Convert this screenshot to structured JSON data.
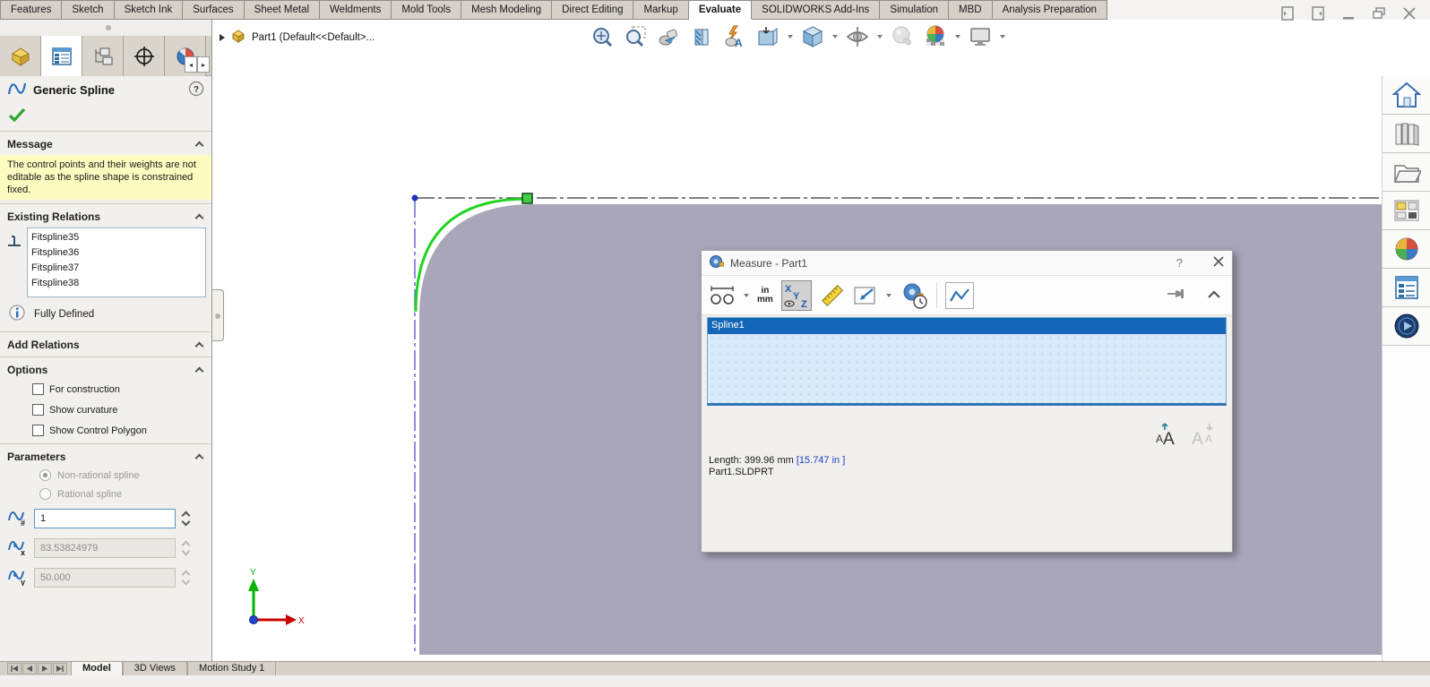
{
  "command_manager": {
    "tabs": [
      "Features",
      "Sketch",
      "Sketch Ink",
      "Surfaces",
      "Sheet Metal",
      "Weldments",
      "Mold Tools",
      "Mesh Modeling",
      "Direct Editing",
      "Markup",
      "Evaluate",
      "SOLIDWORKS Add-Ins",
      "Simulation",
      "MBD",
      "Analysis Preparation"
    ],
    "active_tab": "Evaluate"
  },
  "document_bar": {
    "title": "Part1  (Default<<Default>..."
  },
  "property_manager": {
    "title": "Generic Spline",
    "message": {
      "header": "Message",
      "body": "The control points and their weights are not editable as the spline shape is constrained fixed."
    },
    "existing_relations": {
      "header": "Existing Relations",
      "relations": [
        "Fitspline35",
        "Fitspline36",
        "Fitspline37",
        "Fitspline38"
      ],
      "status": "Fully Defined"
    },
    "add_relations": {
      "header": "Add Relations"
    },
    "options": {
      "header": "Options",
      "checkboxes": [
        "For construction",
        "Show curvature",
        "Show Control Polygon"
      ]
    },
    "parameters": {
      "header": "Parameters",
      "radio_nonrational": "Non-rational spline",
      "radio_rational": "Rational spline",
      "spline_point_number": "1",
      "x_coordinate": "83.53824979",
      "y_coordinate": "50.000"
    }
  },
  "measure_dialog": {
    "title": "Measure - Part1",
    "units_in": "in",
    "units_mm": "mm",
    "selected_item": "Spline1",
    "result_length": "Length: 399.96 mm ",
    "result_length_alt": "[15.747 in ]",
    "result_file": "Part1.SLDPRT"
  },
  "model_tabs": {
    "items": [
      "Model",
      "3D Views",
      "Motion Study 1"
    ],
    "active_tab": "Model"
  },
  "triad": {
    "x_label": "X",
    "y_label": "Y"
  },
  "colors": {
    "selection_blue": "#1467b8",
    "part_gray": "#a9a6ba",
    "spline_green": "#21d421",
    "message_yellow": "#fdfcc0"
  }
}
